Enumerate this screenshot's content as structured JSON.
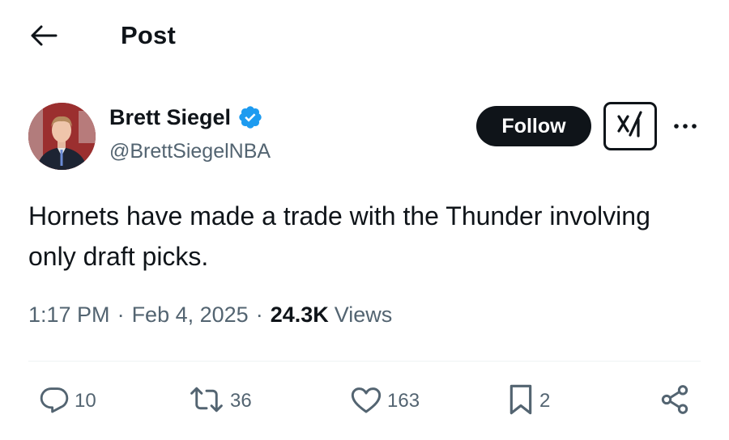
{
  "header": {
    "title": "Post",
    "back_icon": "arrow-left-icon"
  },
  "author": {
    "display_name": "Brett Siegel",
    "handle": "@BrettSiegelNBA",
    "verified": true,
    "verified_color": "#1d9bf0"
  },
  "actions_top": {
    "follow_label": "Follow",
    "grok_icon": "grok-icon",
    "more_icon": "more-icon"
  },
  "tweet": {
    "text": "Hornets have made a trade with the Thunder involving only draft picks.",
    "time": "1:17 PM",
    "date": "Feb 4, 2025",
    "views_count": "24.3K",
    "views_label": "Views",
    "separator": "·"
  },
  "engagement": {
    "replies": "10",
    "reposts": "36",
    "likes": "163",
    "bookmarks": "2"
  },
  "colors": {
    "text_primary": "#0f1419",
    "text_secondary": "#536471",
    "follow_bg": "#0f1419",
    "divider": "#eff3f4"
  }
}
